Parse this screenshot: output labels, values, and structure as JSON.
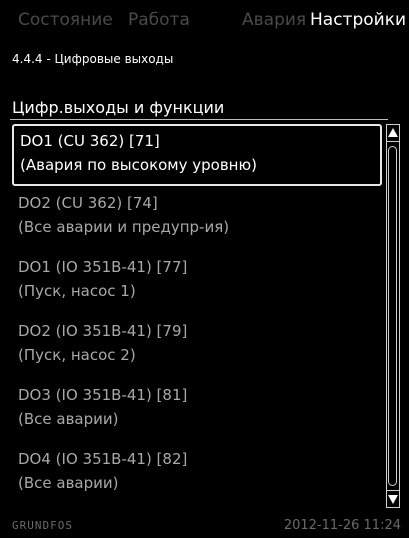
{
  "tabs": [
    {
      "label": "Состояние"
    },
    {
      "label": "Работа"
    },
    {
      "label": "Авария"
    },
    {
      "label": "Настройки"
    }
  ],
  "breadcrumb": "4.4.4 - Цифровые выходы",
  "section": {
    "title": "Цифр.выходы и функции"
  },
  "items": [
    {
      "line1": "DO1 (CU 362) [71]",
      "line2": "(Авария по высокому уровню)"
    },
    {
      "line1": "DO2 (CU 362) [74]",
      "line2": "(Все аварии и предупр-ия)"
    },
    {
      "line1": "DO1 (IO 351B-41) [77]",
      "line2": "(Пуск, насос 1)"
    },
    {
      "line1": "DO2 (IO 351B-41) [79]",
      "line2": "(Пуск, насос 2)"
    },
    {
      "line1": "DO3 (IO 351B-41) [81]",
      "line2": "(Все аварии)"
    },
    {
      "line1": "DO4 (IO 351B-41) [82]",
      "line2": "(Все аварии)"
    }
  ],
  "footer": {
    "brand": "GRUNDFOS",
    "datetime": "2012-11-26 11:24"
  }
}
